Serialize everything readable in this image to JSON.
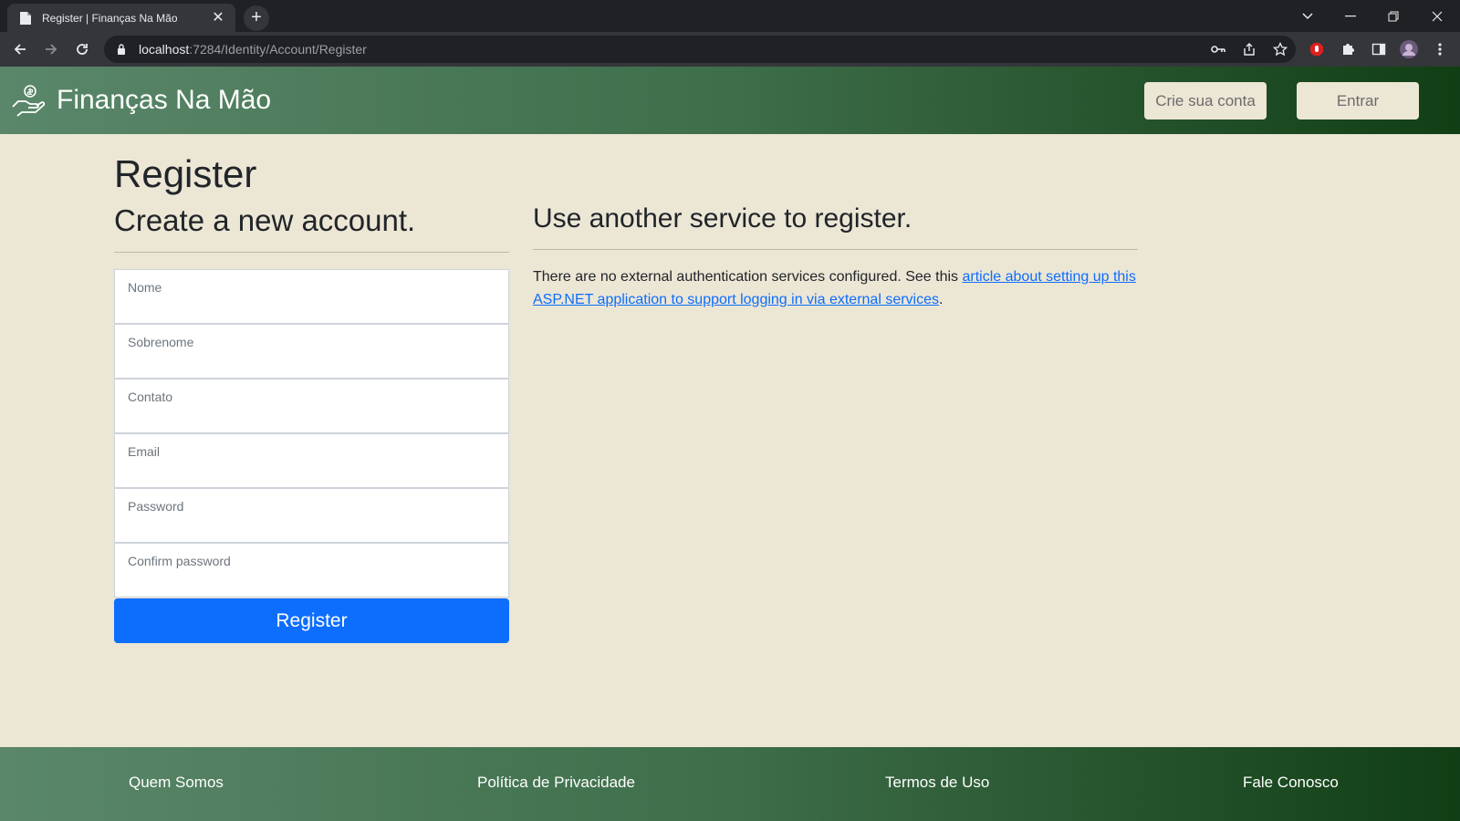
{
  "browser": {
    "tab_title": "Register | Finanças Na Mão",
    "url_host": "localhost",
    "url_path": ":7284/Identity/Account/Register"
  },
  "header": {
    "brand": "Finanças Na Mão",
    "create_account_label": "Crie sua conta",
    "login_label": "Entrar"
  },
  "main": {
    "title": "Register",
    "subtitle": "Create a new account.",
    "fields": [
      {
        "label": "Nome"
      },
      {
        "label": "Sobrenome"
      },
      {
        "label": "Contato"
      },
      {
        "label": "Email"
      },
      {
        "label": "Password"
      },
      {
        "label": "Confirm password"
      }
    ],
    "register_label": "Register"
  },
  "external": {
    "title": "Use another service to register.",
    "text_before": "There are no external authentication services configured. See this ",
    "link_text": "article about setting up this ASP.NET application to support logging in via external services",
    "text_after": "."
  },
  "footer": {
    "links": [
      "Quem Somos",
      "Política de Privacidade",
      "Termos de Uso",
      "Fale Conosco"
    ]
  },
  "colors": {
    "accent": "#0d6efd",
    "page_bg": "#ece6d5",
    "header_green": "#3e6e4a"
  }
}
